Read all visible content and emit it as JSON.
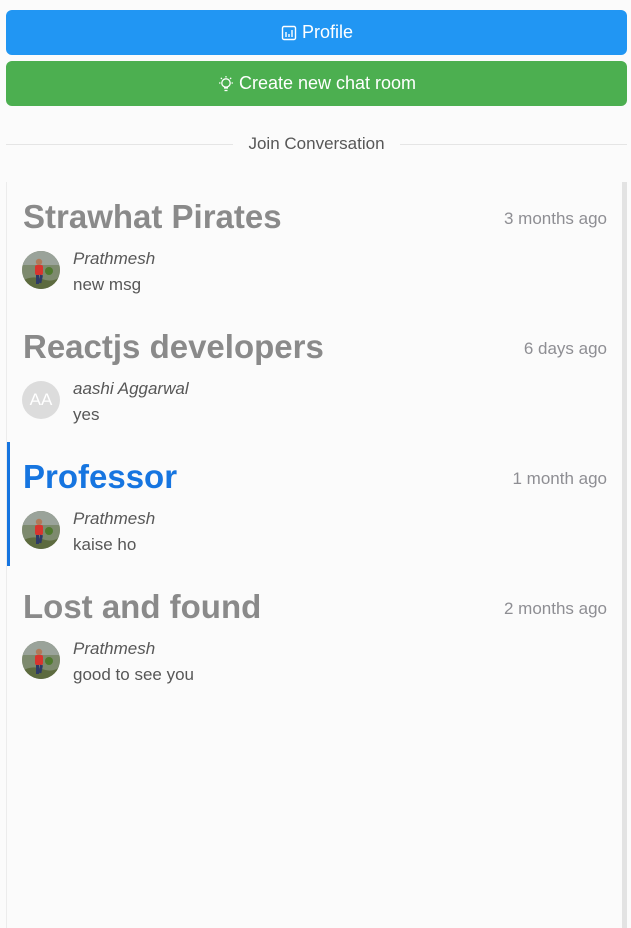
{
  "header": {
    "profile_label": "Profile",
    "create_label": "Create new chat room",
    "divider_label": "Join Conversation"
  },
  "rooms": [
    {
      "name": "Strawhat Pirates",
      "time": "3 months ago",
      "author": "Prathmesh",
      "message": "new msg",
      "avatar": "photo",
      "active": false
    },
    {
      "name": "Reactjs developers",
      "time": "6 days ago",
      "author": "aashi Aggarwal",
      "message": "yes",
      "avatar": "AA",
      "active": false
    },
    {
      "name": "Professor",
      "time": "1 month ago",
      "author": "Prathmesh",
      "message": "kaise ho",
      "avatar": "photo",
      "active": true
    },
    {
      "name": "Lost and found",
      "time": "2 months ago",
      "author": "Prathmesh",
      "message": "good to see you",
      "avatar": "photo",
      "active": false
    }
  ],
  "colors": {
    "profile_button": "#2196f3",
    "create_button": "#4caf50",
    "active_accent": "#1675e0",
    "inactive_title": "#8a8a8a"
  },
  "icons": {
    "profile": "dashboard-icon",
    "create": "creative-bulb-icon"
  }
}
